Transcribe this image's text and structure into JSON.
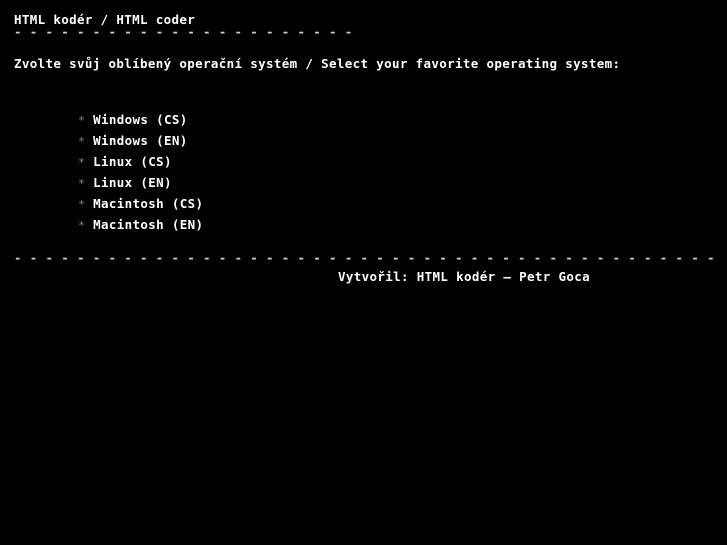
{
  "page": {
    "background_color": "#000000",
    "text_color": "#ffffff",
    "rule_color": "#cfcfcf",
    "bullet_color": "#8a8a8a"
  },
  "header": {
    "title": "HTML kodér / HTML coder",
    "title_rule": "- - - - - - - - - - - - - - - - - - - - - -",
    "subtitle": "Zvolte svůj oblíbený operační systém / Select your favorite operating system:"
  },
  "os_list": {
    "bullet_glyph": "*",
    "items": [
      {
        "label": "Windows (CS)"
      },
      {
        "label": "Windows (EN)"
      },
      {
        "label": "Linux (CS)"
      },
      {
        "label": "Linux (EN)"
      },
      {
        "label": "Macintosh (CS)"
      },
      {
        "label": "Macintosh (EN)"
      }
    ]
  },
  "footer": {
    "rule": "- - - - - - - - - - - - - - - - - - - - - - - - - - - - - - - - - - - - - - - - - - - - -",
    "credit": "Vytvořil: HTML kodér – Petr Goca"
  }
}
